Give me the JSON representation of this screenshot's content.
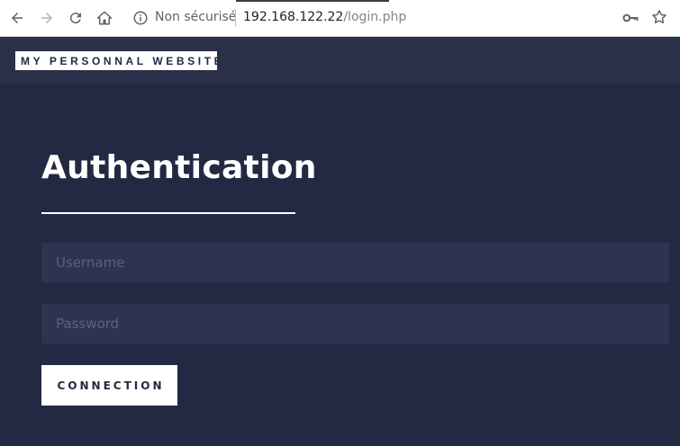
{
  "browser": {
    "security_label": "Non sécurisé",
    "url_host": "192.168.122.22",
    "url_path": "/login.php",
    "icons": [
      "back-icon",
      "forward-icon",
      "reload-icon",
      "home-icon",
      "info-icon",
      "key-icon",
      "star-icon"
    ]
  },
  "site": {
    "logo_text": "MY PERSONNAL WEBSITE"
  },
  "main": {
    "title": "Authentication",
    "username_placeholder": "Username",
    "username_value": "",
    "password_placeholder": "Password",
    "password_value": "",
    "connect_label": "CONNECTION"
  },
  "colors": {
    "background": "#242943",
    "header": "#2a2f4a",
    "field": "#2e3350",
    "text": "#ffffff"
  }
}
